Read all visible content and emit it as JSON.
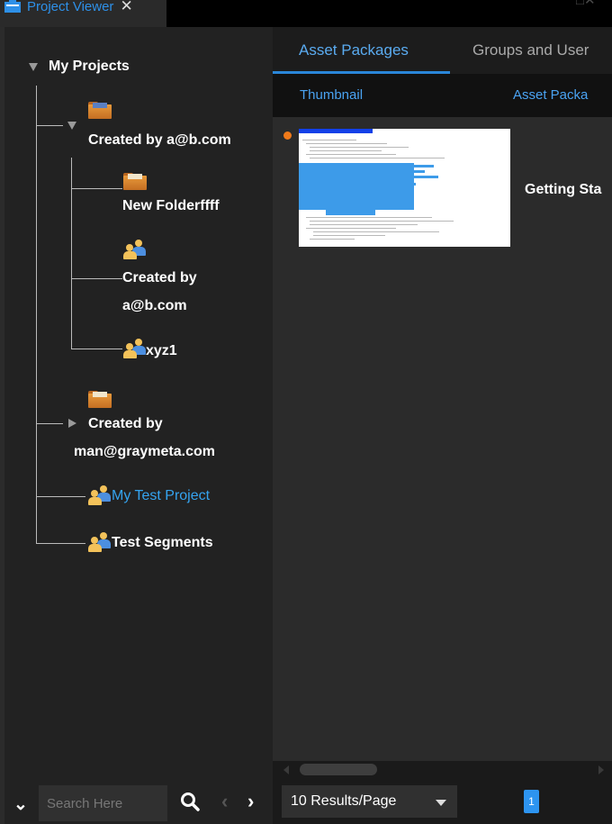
{
  "window": {
    "tab_title": "Project Viewer",
    "close_glyph": "✕",
    "controls_glyph": "□✕"
  },
  "tree": {
    "root_label": "My Projects",
    "nodes": [
      {
        "label": "Created by a@b.com",
        "icon": "folder-users-icon",
        "expanded": true,
        "children": [
          {
            "label": "New Folderffff",
            "icon": "folder-icon"
          },
          {
            "label_line1": "Created by",
            "label_line2": "a@b.com",
            "icon": "users-icon"
          },
          {
            "label": "xyz1",
            "icon": "users-icon"
          }
        ]
      },
      {
        "label_line1": "Created by",
        "label_line2": "man@graymeta.com",
        "icon": "folder-icon",
        "expanded": false
      },
      {
        "label": "My Test Project",
        "icon": "users-icon",
        "selected": true
      },
      {
        "label": "Test Segments",
        "icon": "users-icon"
      }
    ]
  },
  "search": {
    "placeholder": "Search Here"
  },
  "main": {
    "tabs": [
      "Asset Packages",
      "Groups and User"
    ],
    "active_tab": "Asset Packages",
    "columns": [
      "Thumbnail",
      "Asset Packa"
    ],
    "rows": [
      {
        "name": "Getting Sta",
        "status_color": "#f07a1a"
      }
    ],
    "results_per_page": "10 Results/Page",
    "current_page": "1"
  },
  "colors": {
    "accent": "#2e90e8",
    "selected_text": "#35a4f0",
    "status_dot": "#f07a1a"
  }
}
